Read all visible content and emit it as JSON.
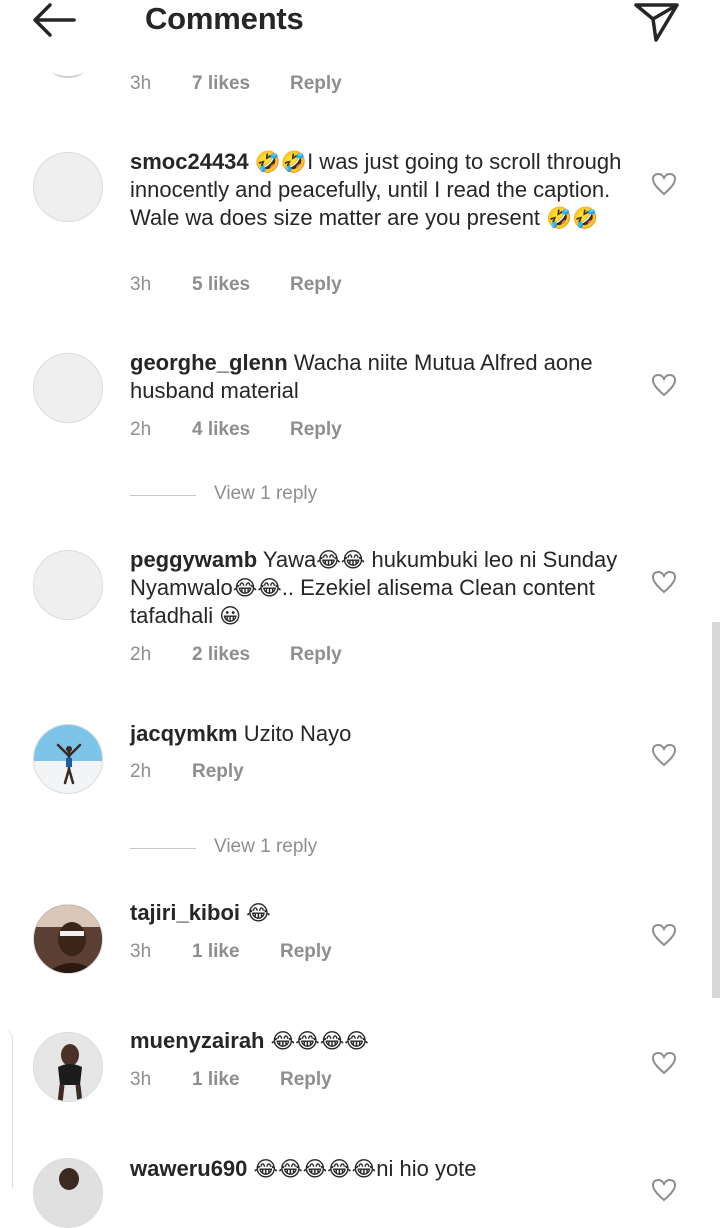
{
  "header": {
    "title": "Comments",
    "back_icon": "arrow-left-icon",
    "send_icon": "paper-plane-icon"
  },
  "partial_comment": {
    "time": "3h",
    "likes": "7 likes",
    "reply": "Reply"
  },
  "comments": [
    {
      "username": "smoc24434",
      "text_parts": [
        "🤣🤣",
        "I was just going to scroll through innocently and peacefully, until I read the caption. Wale wa does size matter are you present ",
        "🤣🤣"
      ],
      "time": "3h",
      "likes": "5 likes",
      "reply": "Reply"
    },
    {
      "username": "georghe_glenn",
      "text_parts": [
        "Wacha niite Mutua Alfred aone husband material"
      ],
      "time": "2h",
      "likes": "4 likes",
      "reply": "Reply",
      "view_replies": "View 1 reply"
    },
    {
      "username": "peggywamb",
      "text_parts": [
        "Yawa",
        "😂😂",
        " hukumbuki leo ni Sunday Nyamwalo",
        "😂😂",
        ".. Ezekiel alisema Clean content tafadhali ",
        "😀"
      ],
      "time": "2h",
      "likes": "2 likes",
      "reply": "Reply"
    },
    {
      "username": "jacqymkm",
      "text_parts": [
        "Uzito Nayo"
      ],
      "time": "2h",
      "reply": "Reply",
      "view_replies": "View 1 reply"
    },
    {
      "username": "tajiri_kiboi",
      "text_parts": [
        "😂"
      ],
      "time": "3h",
      "likes": "1 like",
      "reply": "Reply"
    },
    {
      "username": "muenyzairah",
      "text_parts": [
        "😂😂😂😂"
      ],
      "time": "3h",
      "likes": "1 like",
      "reply": "Reply"
    },
    {
      "username": "waweru690",
      "text_parts": [
        "😂😂😂😂😂",
        "ni hio yote"
      ]
    }
  ],
  "colors": {
    "text": "#262626",
    "meta": "#8e8e8e",
    "divider": "#c7c7c7"
  }
}
